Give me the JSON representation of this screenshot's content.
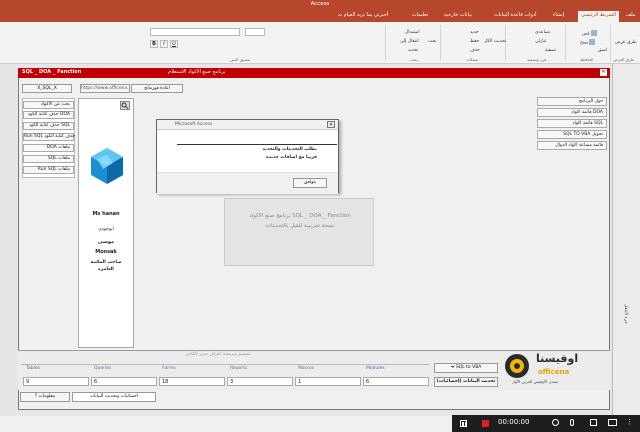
{
  "app": {
    "title": "Access"
  },
  "ribbon": {
    "tabs": [
      "ملف",
      "الشريط الرئيسي",
      "إنشاء",
      "أدوات قاعدة البيانات",
      "بيانات خارجية",
      "تعليمات",
      "أخبرني بما تريد القيام به"
    ],
    "active_tab": "الشريط الرئيسي",
    "buttons": {
      "view": "طرق عرض",
      "cut": "قص",
      "copy": "نسخ",
      "paste": "لصق",
      "filter": "تصفية",
      "ascending": "تصاعدي",
      "descending": "تنازلي",
      "refresh": "تحديث الكل",
      "new": "جديد",
      "save": "حفظ",
      "delete": "حذف",
      "find": "بحث",
      "replace": "استبدال",
      "goto": "انتقال إلى",
      "select": "تحديد"
    },
    "groups": {
      "views": "طرق العرض",
      "clipboard": "الحافظة",
      "sort_filter": "فرز وتصفية",
      "records": "سجلات",
      "find": "بحث",
      "text_format": "تنسيق النص"
    }
  },
  "form": {
    "title_left": "SQL _ DOA _ Fanction",
    "title_center": "برنامج صنع الاكواد الاستعلام",
    "top_buttons": {
      "url": "https://www.officena.net",
      "copy": "اعادة فورماتج",
      "x_sql": "X_SQL_X"
    },
    "left_menu": [
      "بحث عن الاكواد",
      "حذف كتابة الكود DOA",
      "حذف كتابة الكود SQL",
      "Run SQL حذف كتابة الكود",
      "DOA ملفات",
      "SQL ملفات",
      "Run SQL ملفات"
    ],
    "profile": {
      "name": "Ms hanan",
      "line2": "ابوخودي",
      "name2": "موسى",
      "name3": "Moosak",
      "role": "صاحب المكتبة العامرة"
    },
    "center_text": {
      "line1": "برنامج صنع الاكواد SQL _ DOA _ Fanction",
      "line2": "نسخة تجريبية للقبل بالتحديثات"
    },
    "right_menu": [
      "حول البرنامج",
      "قائمة اكواد DOA",
      "قائمة اكواد SQL",
      "SQL TO VBA تحويل",
      "قائمة مشاعة اكواد الدوال"
    ]
  },
  "dialog": {
    "title": "Microsoft Access",
    "message1": "بطلب التحديثات والتجديد",
    "message2": "قريبا مع اضافات جديدة",
    "ok": "موافق"
  },
  "stats": {
    "notice": "تمسبم وبرمجة أعراف مدير الكادي",
    "headers": [
      "Tables",
      "Queries",
      "Forms",
      "Reports",
      "Macros",
      "Modules"
    ],
    "values": [
      "9",
      "6",
      "18",
      "3",
      "1",
      "6"
    ],
    "sql_vba_btn": "SQL to VBA",
    "update_btn": "تحديث البيانات (إحصائيات)"
  },
  "logo": {
    "brand": "اوفيسنا",
    "brand_en": "officena",
    "tagline": "منتدى الأوفيس العربي الأول"
  },
  "bottom_tabs": [
    "احصائيات وتحديث البيانات",
    "معلومات ؟"
  ],
  "nav_pane": {
    "label": "جزء التنقل"
  },
  "recorder": {
    "time": "00:00:00"
  }
}
